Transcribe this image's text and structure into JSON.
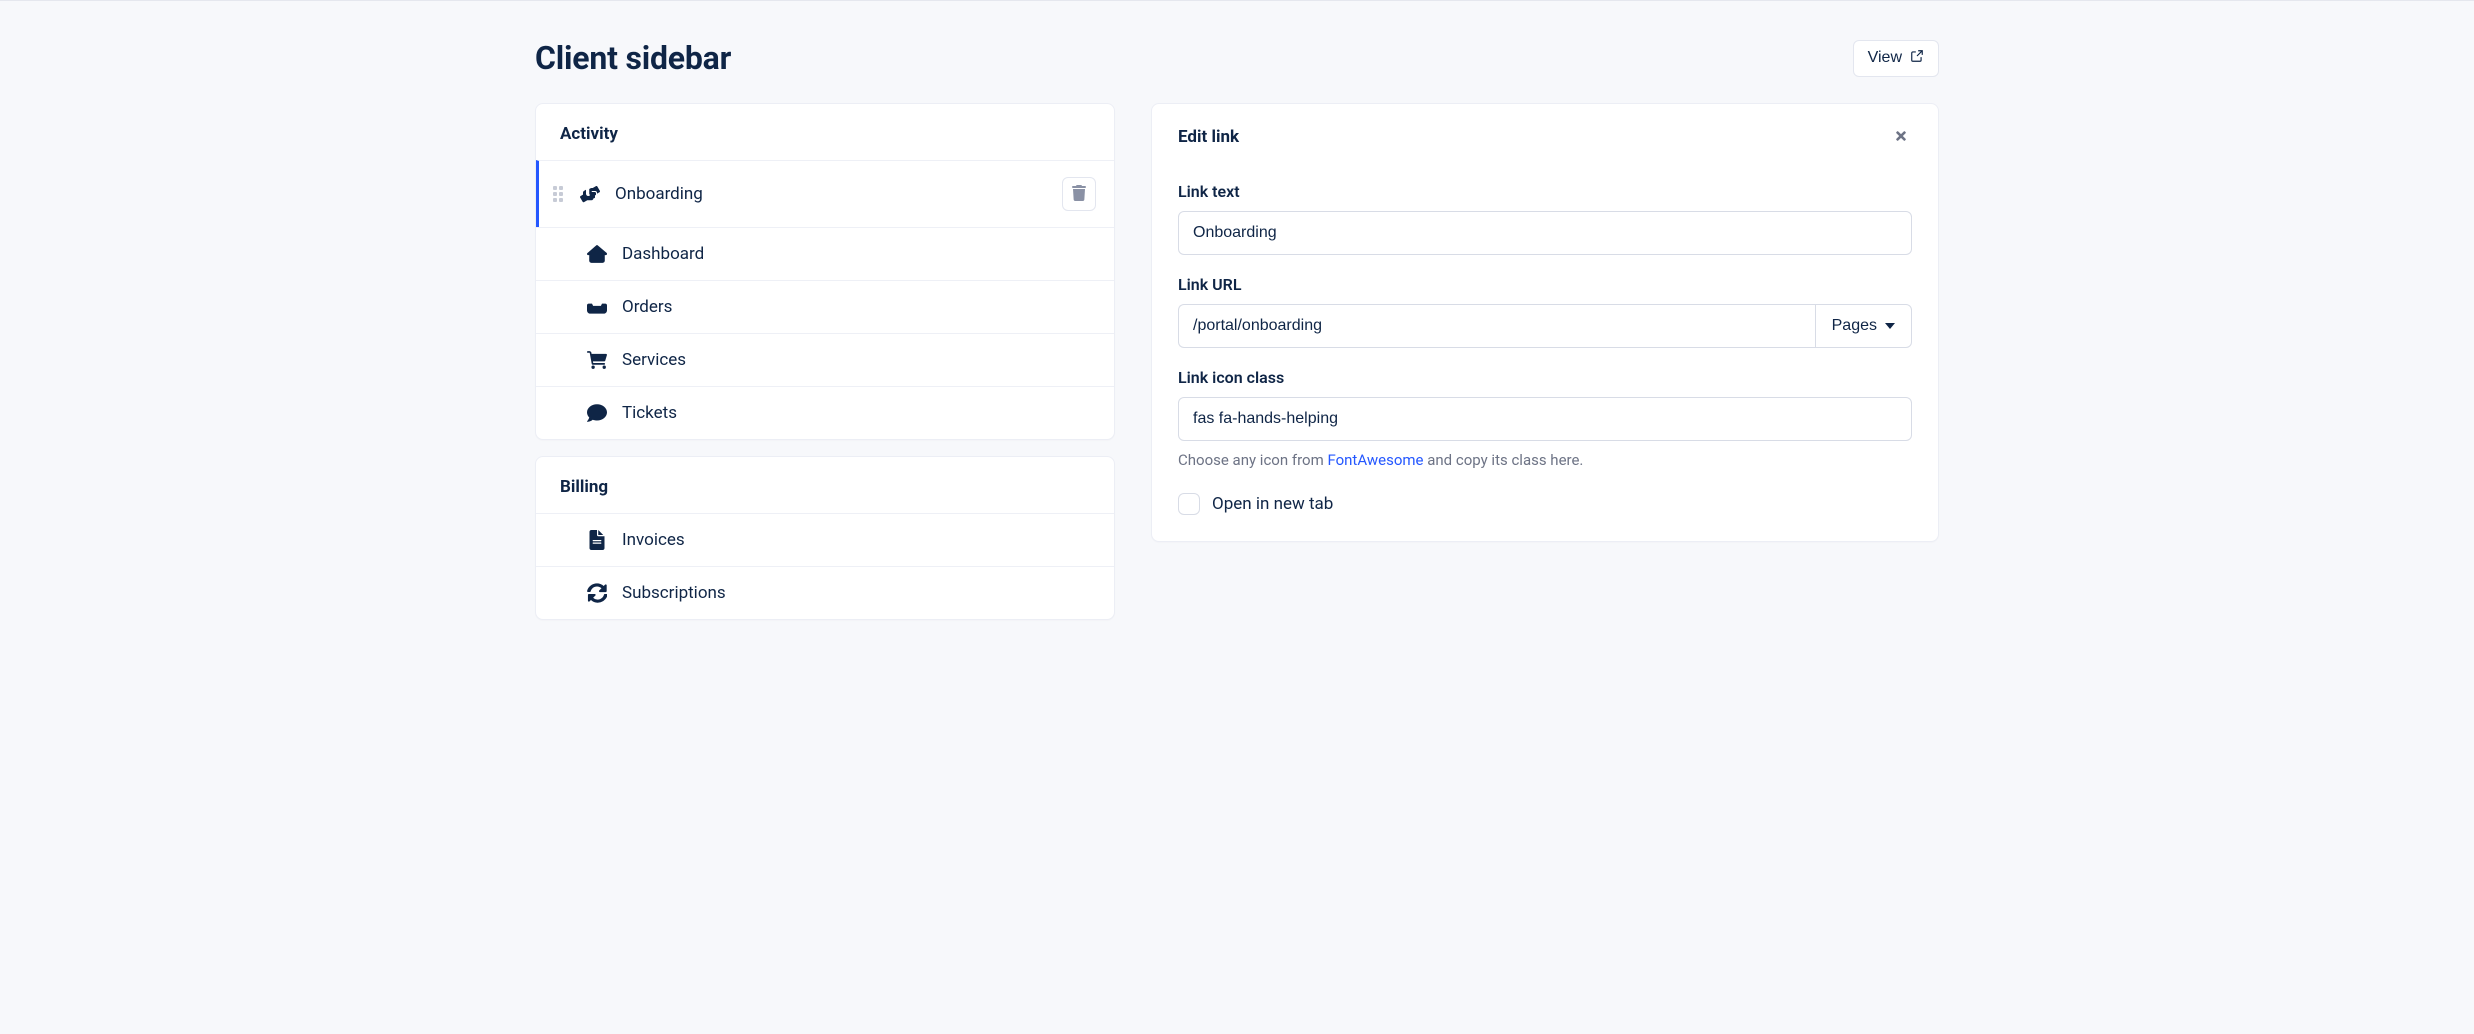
{
  "header": {
    "title": "Client sidebar",
    "view_label": "View"
  },
  "sidebar_sections": [
    {
      "title": "Activity",
      "items": [
        {
          "label": "Onboarding",
          "icon": "hands-helping",
          "active": true
        },
        {
          "label": "Dashboard",
          "icon": "home",
          "active": false
        },
        {
          "label": "Orders",
          "icon": "inbox",
          "active": false
        },
        {
          "label": "Services",
          "icon": "cart",
          "active": false
        },
        {
          "label": "Tickets",
          "icon": "comment",
          "active": false
        }
      ]
    },
    {
      "title": "Billing",
      "items": [
        {
          "label": "Invoices",
          "icon": "file",
          "active": false
        },
        {
          "label": "Subscriptions",
          "icon": "sync",
          "active": false
        }
      ]
    }
  ],
  "edit_panel": {
    "title": "Edit link",
    "link_text_label": "Link text",
    "link_text_value": "Onboarding",
    "link_url_label": "Link URL",
    "link_url_value": "/portal/onboarding",
    "pages_dropdown_label": "Pages",
    "link_icon_label": "Link icon class",
    "link_icon_value": "fas fa-hands-helping",
    "help_prefix": "Choose any icon from ",
    "help_link_text": "FontAwesome",
    "help_suffix": " and copy its class here.",
    "open_new_tab_label": "Open in new tab",
    "open_new_tab_checked": false
  }
}
